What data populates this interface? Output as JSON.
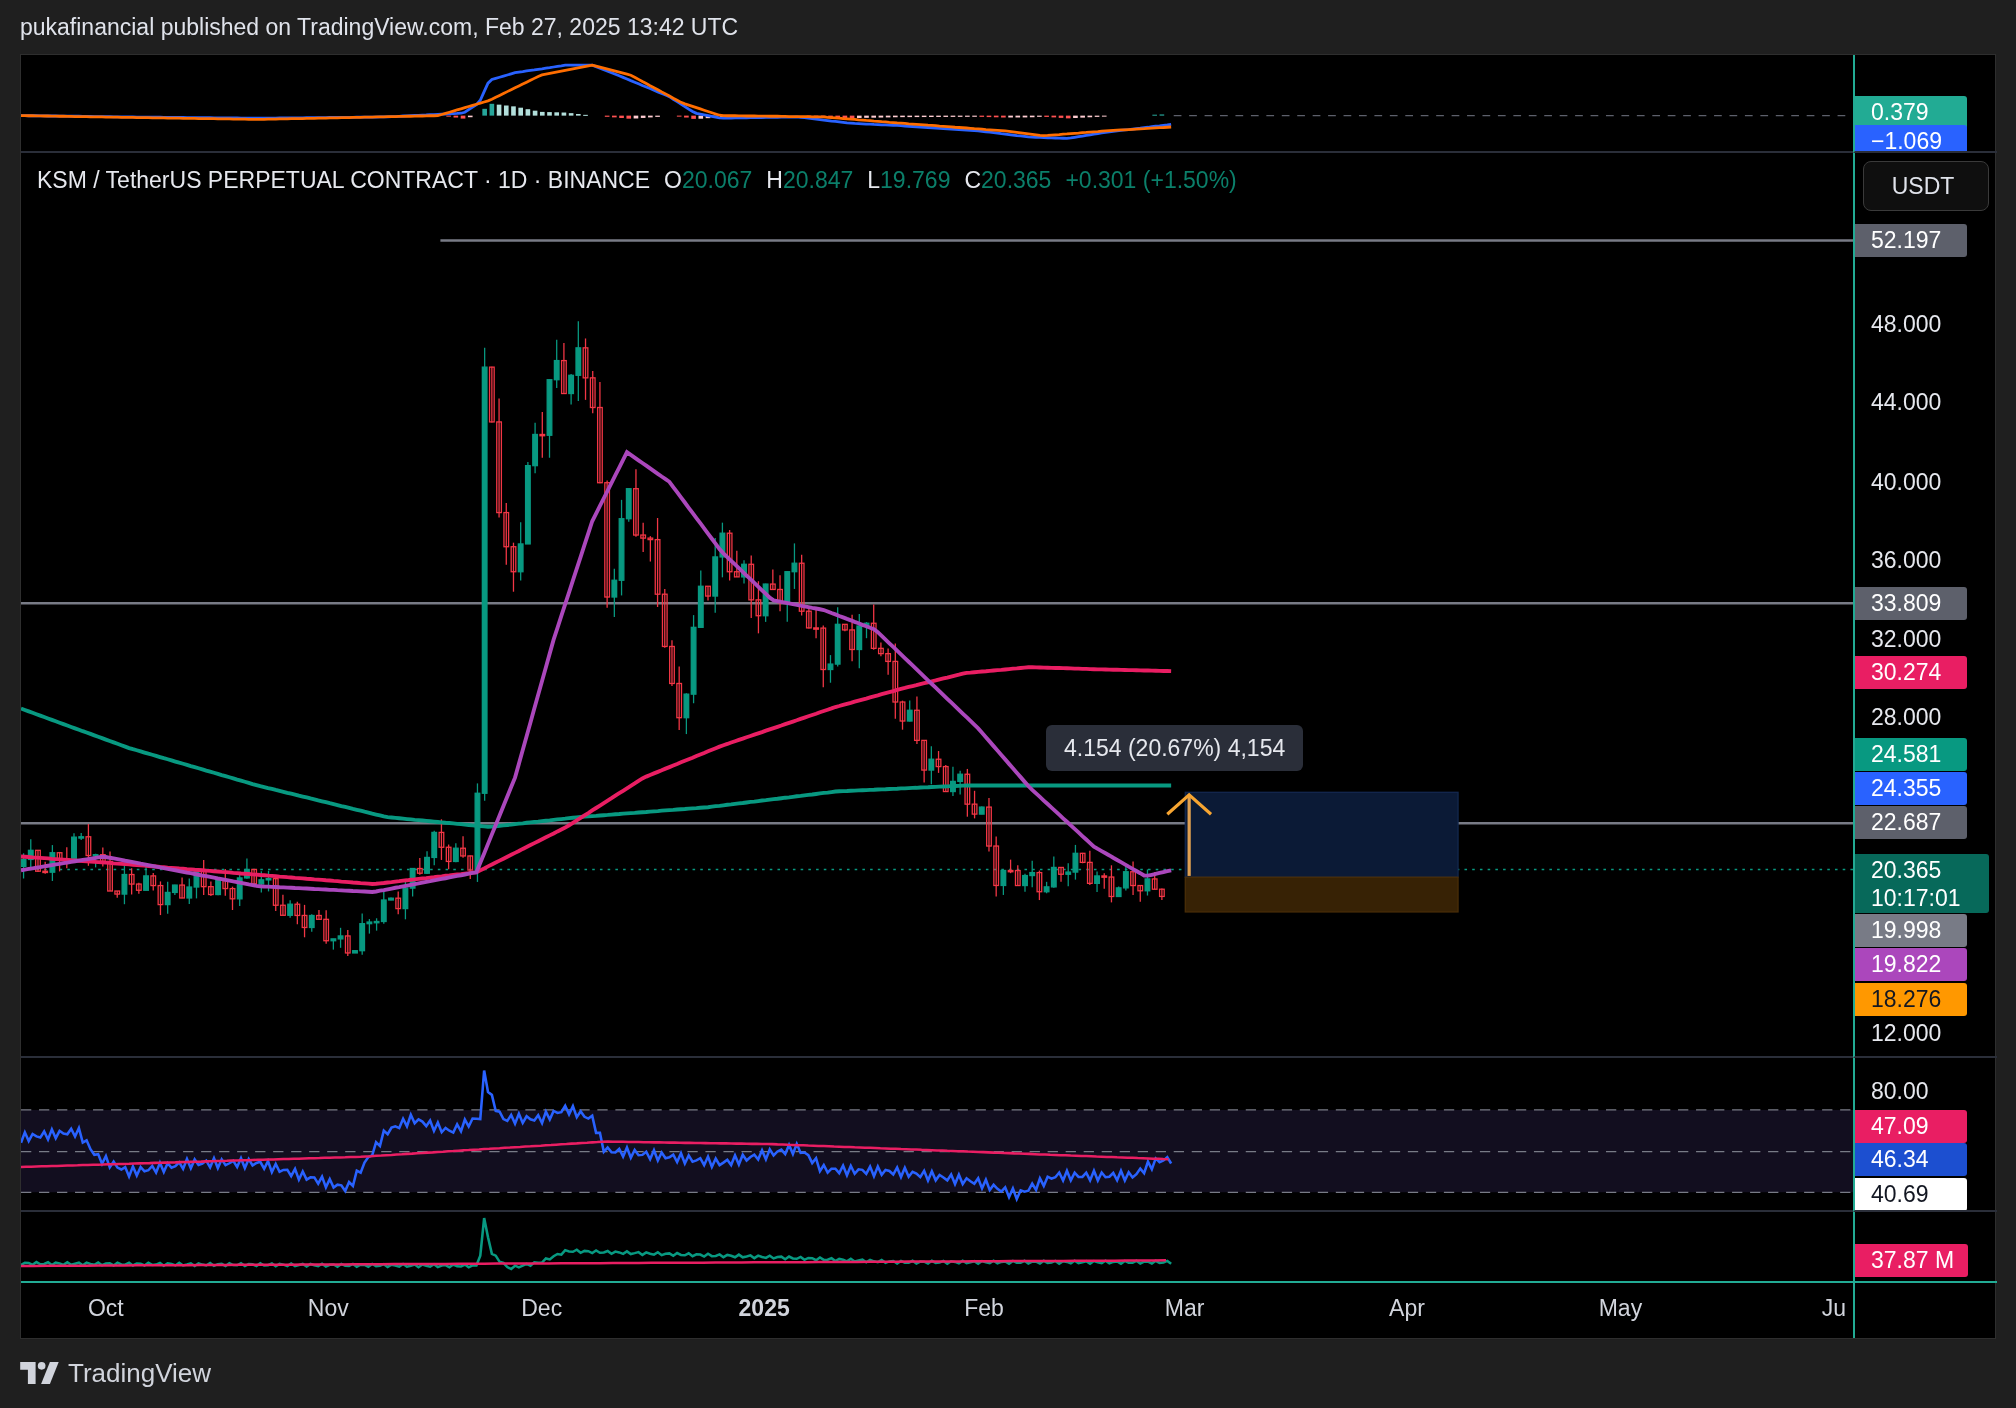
{
  "header": {
    "publisher_line": "pukafinancial published on TradingView.com, Feb 27, 2025 13:42 UTC"
  },
  "macd_pane": {
    "axis_labels": [
      {
        "text": "0.379",
        "kind": "badge",
        "color": "#22ab94"
      },
      {
        "text": "−1.069",
        "kind": "badge",
        "color": "#2962ff"
      }
    ]
  },
  "price_pane": {
    "legend": {
      "symbol": "KSM / TetherUS PERPETUAL CONTRACT · 1D · BINANCE",
      "ohlc": [
        {
          "label": "O",
          "value": "20.067"
        },
        {
          "label": "H",
          "value": "20.847"
        },
        {
          "label": "L",
          "value": "19.769"
        },
        {
          "label": "C",
          "value": "20.365"
        }
      ],
      "change": "+0.301 (+1.50%)"
    },
    "currency_button": "USDT",
    "measure_tooltip": "4.154 (20.67%) 4,154",
    "axis_labels": [
      {
        "text": "52.197",
        "kind": "badge",
        "color": "#5d606b"
      },
      {
        "text": "48.000",
        "kind": "tick"
      },
      {
        "text": "44.000",
        "kind": "tick"
      },
      {
        "text": "40.000",
        "kind": "tick"
      },
      {
        "text": "36.000",
        "kind": "tick"
      },
      {
        "text": "33.809",
        "kind": "badge",
        "color": "#5d606b"
      },
      {
        "text": "32.000",
        "kind": "tick"
      },
      {
        "text": "30.274",
        "kind": "badge",
        "color": "#e91e63"
      },
      {
        "text": "28.000",
        "kind": "tick"
      },
      {
        "text": "24.581",
        "kind": "badge",
        "color": "#089981"
      },
      {
        "text": "24.355",
        "kind": "badge",
        "color": "#2962ff"
      },
      {
        "text": "22.687",
        "kind": "badge",
        "color": "#5d606b"
      },
      {
        "text": "20.365",
        "kind": "badge",
        "color": "#07695a",
        "subtext": "10:17:01"
      },
      {
        "text": "19.998",
        "kind": "badge",
        "color": "#787b86"
      },
      {
        "text": "19.822",
        "kind": "badge",
        "color": "#ab47bc"
      },
      {
        "text": "18.276",
        "kind": "badge",
        "color": "#ff9800"
      },
      {
        "text": "12.000",
        "kind": "tick"
      }
    ]
  },
  "rsi_pane": {
    "axis_labels": [
      {
        "text": "80.00",
        "kind": "tick"
      },
      {
        "text": "47.09",
        "kind": "badge",
        "color": "#e91e63"
      },
      {
        "text": "46.34",
        "kind": "badge",
        "color": "#1c4fd0"
      },
      {
        "text": "40.69",
        "kind": "badge",
        "color": "#ffffff"
      }
    ]
  },
  "volume_pane": {
    "axis_labels": [
      {
        "text": "37.87 M",
        "kind": "badge",
        "color": "#e91e63"
      }
    ]
  },
  "time_axis": {
    "labels": [
      {
        "text": "Oct",
        "bold": false
      },
      {
        "text": "Nov",
        "bold": false
      },
      {
        "text": "Dec",
        "bold": false
      },
      {
        "text": "2025",
        "bold": true
      },
      {
        "text": "Feb",
        "bold": false
      },
      {
        "text": "Mar",
        "bold": false
      },
      {
        "text": "Apr",
        "bold": false
      },
      {
        "text": "May",
        "bold": false
      },
      {
        "text": "Ju",
        "bold": false
      }
    ]
  },
  "footer": {
    "logo_text": "TradingView"
  }
}
